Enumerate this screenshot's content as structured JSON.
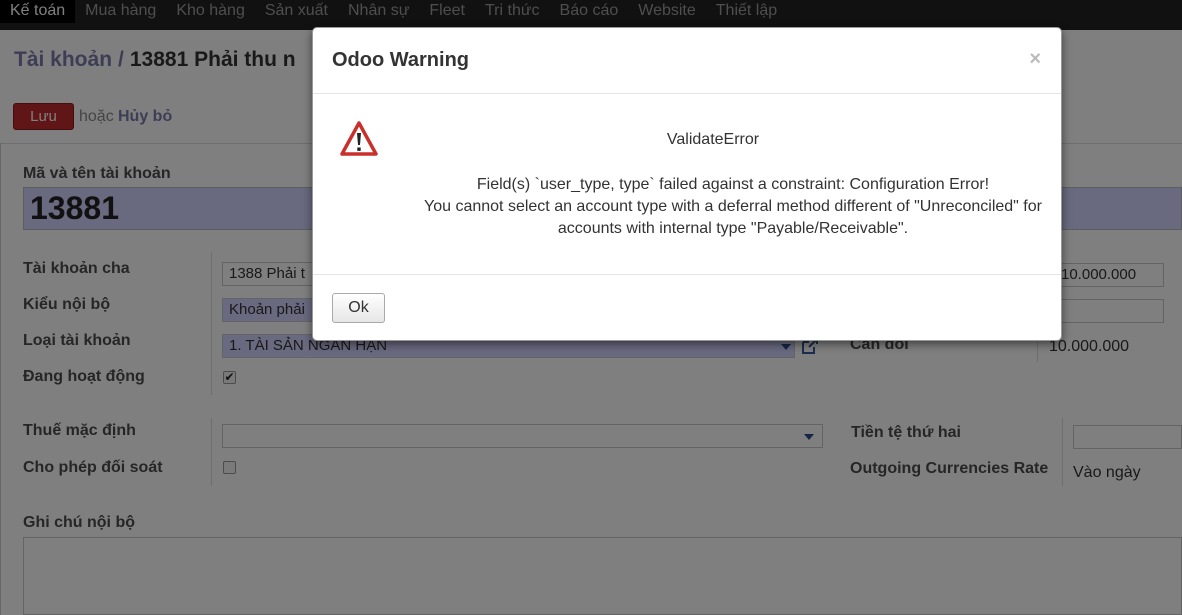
{
  "menu": [
    "Kế toán",
    "Mua hàng",
    "Kho hàng",
    "Sản xuất",
    "Nhân sự",
    "Fleet",
    "Tri thức",
    "Báo cáo",
    "Website",
    "Thiết lập"
  ],
  "breadcrumb": {
    "parent": "Tài khoản",
    "separator": "/",
    "current": "13881 Phải thu n"
  },
  "buttons": {
    "save": "Lưu",
    "or": "hoặc",
    "discard": "Hủy bỏ"
  },
  "form": {
    "code_name_label": "Mã và tên tài khoản",
    "code_value": "13881",
    "parent_label": "Tài khoản cha",
    "parent_value": "1388 Phải t",
    "internal_type_label": "Kiểu nội bộ",
    "internal_type_value": "Khoản phải",
    "account_type_label": "Loại tài khoản",
    "account_type_value": "1. TÀI SẢN NGẮN HẠN",
    "active_label": "Đang hoạt động",
    "active_checked": true,
    "tax_label": "Thuế mặc định",
    "tax_value": "",
    "reconcile_label": "Cho phép đối soát",
    "reconcile_checked": false,
    "notes_label": "Ghi chú nội bộ",
    "right_value_1": "10.000.000",
    "balance_label": "Cân đối",
    "balance_value": "10.000.000",
    "secondary_currency_label": "Tiền tệ thứ hai",
    "outgoing_rate_label": "Outgoing Currencies Rate",
    "outgoing_rate_value": "Vào ngày"
  },
  "dialog": {
    "title": "Odoo Warning",
    "close": "×",
    "error_title": "ValidateError",
    "message_line1": "Field(s) `user_type, type` failed against a constraint: Configuration Error!",
    "message_line2": "You cannot select an account type with a deferral method different of \"Unreconciled\" for",
    "message_line3": "accounts with internal type \"Payable/Receivable\".",
    "ok": "Ok"
  },
  "colors": {
    "warning_red": "#c9302c",
    "required_field": "#d2d2ff",
    "save_button": "#c02c2c"
  }
}
